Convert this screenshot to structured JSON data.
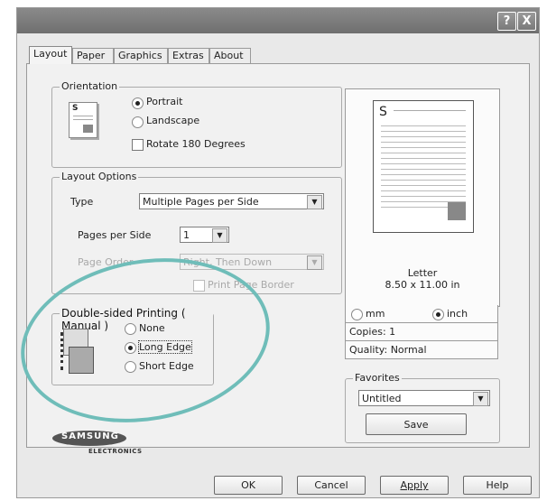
{
  "titlebar": {
    "help_label": "?",
    "close_label": "X"
  },
  "tabs": [
    {
      "label": "Layout",
      "active": true
    },
    {
      "label": "Paper"
    },
    {
      "label": "Graphics"
    },
    {
      "label": "Extras"
    },
    {
      "label": "About"
    }
  ],
  "orientation": {
    "title": "Orientation",
    "portrait": "Portrait",
    "landscape": "Landscape",
    "rotate": "Rotate 180 Degrees",
    "selected": "Portrait",
    "icon_letter": "S"
  },
  "layout_options": {
    "title": "Layout Options",
    "type_label": "Type",
    "type_value": "Multiple Pages per Side",
    "pages_per_side_label": "Pages per Side",
    "pages_per_side_value": "1",
    "page_order_label": "Page Order",
    "page_order_value": "Right, Then Down",
    "print_border_label": "Print Page Border"
  },
  "duplex": {
    "title": "Double-sided Printing ( Manual )",
    "none": "None",
    "long_edge": "Long Edge",
    "short_edge": "Short Edge",
    "selected": "Long Edge"
  },
  "preview": {
    "page_letter": "S",
    "paper_name": "Letter",
    "paper_size": "8.50 x 11.00 in",
    "unit_mm": "mm",
    "unit_inch": "inch",
    "selected_unit": "inch",
    "copies": "Copies: 1",
    "quality": "Quality: Normal"
  },
  "favorites": {
    "title": "Favorites",
    "value": "Untitled",
    "save_label": "Save"
  },
  "logo": {
    "brand": "SAMSUNG",
    "sub": "ELECTRONICS"
  },
  "buttons": {
    "ok": "OK",
    "cancel": "Cancel",
    "apply": "Apply",
    "help": "Help"
  },
  "colors": {
    "highlight_ellipse": "#6fbdb9",
    "titlebar": "#7a7a7a"
  }
}
